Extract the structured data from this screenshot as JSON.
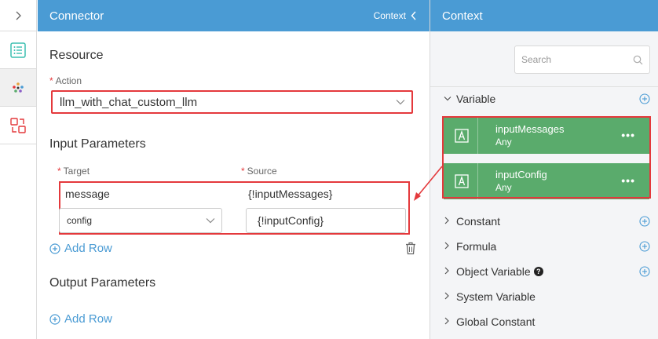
{
  "connector": {
    "title": "Connector",
    "context_toggle": "Context",
    "resource_title": "Resource",
    "action_label": "Action",
    "action_value": "llm_with_chat_custom_llm",
    "input_params_title": "Input Parameters",
    "target_label": "Target",
    "source_label": "Source",
    "rows": [
      {
        "target": "message",
        "source": "{!inputMessages}"
      },
      {
        "target": "config",
        "source": "{!inputConfig}"
      }
    ],
    "add_row": "Add Row",
    "output_params_title": "Output Parameters"
  },
  "context": {
    "title": "Context",
    "search_placeholder": "Search",
    "variable_label": "Variable",
    "variables": [
      {
        "name": "inputMessages",
        "type": "Any"
      },
      {
        "name": "inputConfig",
        "type": "Any"
      }
    ],
    "sections": [
      "Constant",
      "Formula",
      "Object Variable",
      "System Variable",
      "Global Constant"
    ]
  },
  "colors": {
    "header": "#4a9bd4",
    "accent": "#4a9bd4",
    "highlight": "#e4393c",
    "variable_card": "#5aab6c"
  }
}
